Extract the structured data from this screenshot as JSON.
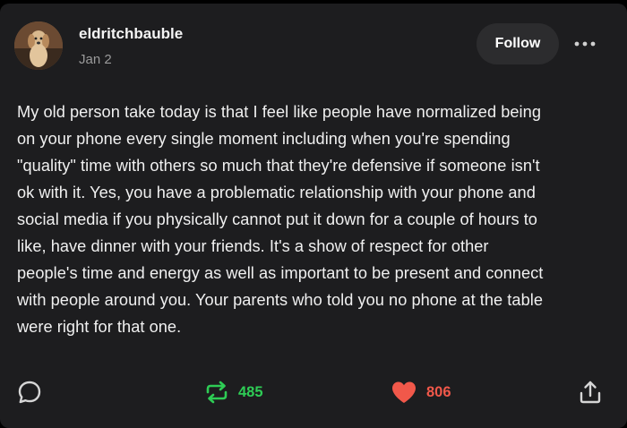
{
  "post": {
    "author": "eldritchbauble",
    "date": "Jan 2",
    "follow_label": "Follow",
    "body_lines": [
      "My old person take today is that I feel like people have normalized being",
      "on your phone every single moment including when you're spending",
      "\"quality\" time with others so much that they're defensive if someone isn't",
      "ok with it. Yes, you have a problematic relationship with your phone and",
      "social media if you physically cannot put it down for a couple of hours to",
      "like, have dinner with your friends. It's a show of respect for other",
      "people's time and energy as well as important to be present and connect",
      "with people around you. Your parents who told you no phone at the table",
      "were right for that one."
    ]
  },
  "actions": {
    "comment_icon": "comment-icon",
    "repost_icon": "repost-icon",
    "repost_count": "485",
    "like_icon": "heart-icon",
    "like_count": "806",
    "share_icon": "share-icon"
  },
  "colors": {
    "background": "#1d1d1f",
    "repost_green": "#2ecc55",
    "like_red": "#f1584a",
    "muted": "#9a9a9a"
  }
}
